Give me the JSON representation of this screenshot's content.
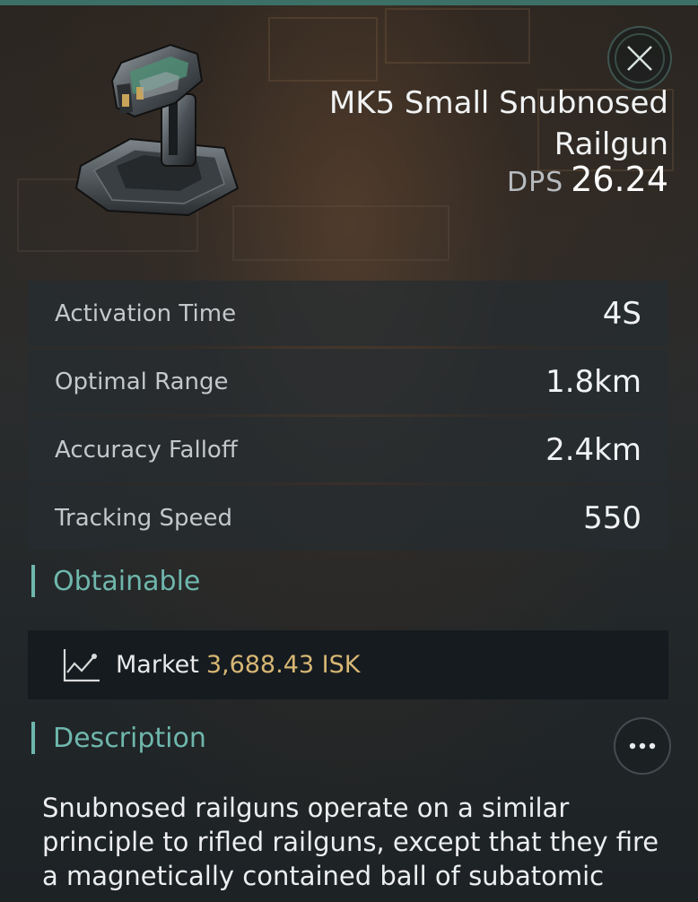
{
  "item": {
    "title": "MK5 Small Snubnosed Railgun",
    "dps_label": "DPS",
    "dps_value": "26.24"
  },
  "stats": [
    {
      "label": "Activation Time",
      "value": "4S"
    },
    {
      "label": "Optimal Range",
      "value": "1.8km"
    },
    {
      "label": "Accuracy Falloff",
      "value": "2.4km"
    },
    {
      "label": "Tracking Speed",
      "value": "550"
    }
  ],
  "obtainable": {
    "heading": "Obtainable",
    "market_label": "Market",
    "market_price": "3,688.43 ISK"
  },
  "description": {
    "heading": "Description",
    "text": "Snubnosed railguns operate on a similar principle to rifled railguns, except that they fire a magnetically contained ball of subatomic"
  },
  "icons": {
    "close": "close-icon",
    "market": "market-chart-icon",
    "more": "more-icon",
    "item": "railgun-item-image"
  },
  "colors": {
    "accent": "#6fb7ad",
    "price": "#d7b774",
    "topbar": "#3c6f66"
  }
}
